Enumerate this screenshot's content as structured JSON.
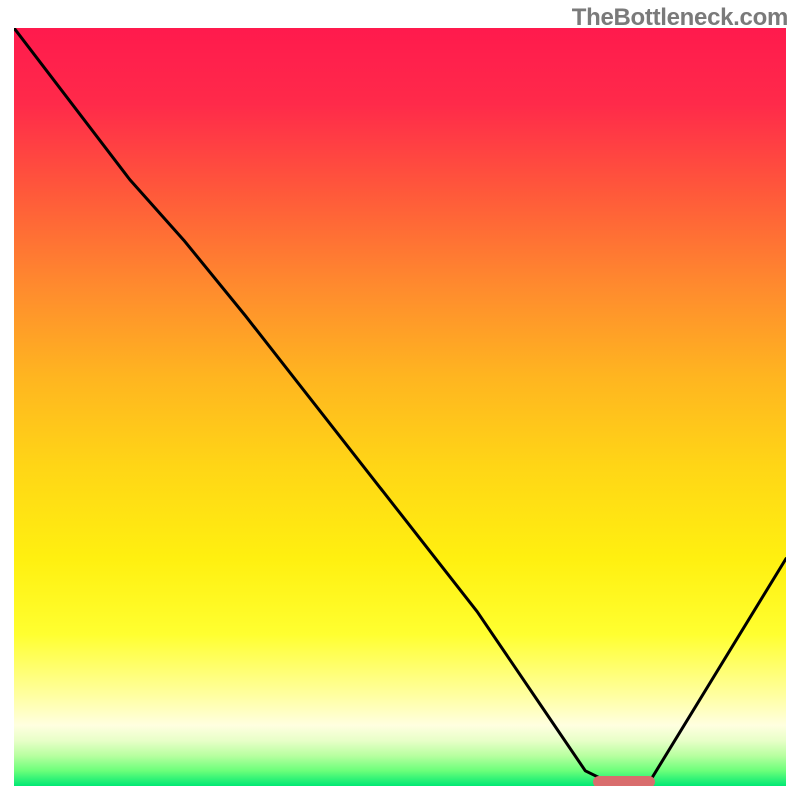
{
  "attribution": "TheBottleneck.com",
  "chart_data": {
    "type": "line",
    "title": "",
    "xlabel": "",
    "ylabel": "",
    "xlim": [
      0,
      100
    ],
    "ylim": [
      0,
      100
    ],
    "series": [
      {
        "name": "bottleneck-curve",
        "x": [
          0,
          15,
          22,
          30,
          40,
          50,
          60,
          68,
          74,
          78,
          82,
          100
        ],
        "y": [
          100,
          80,
          72,
          62,
          49,
          36,
          23,
          11,
          2,
          0,
          0,
          30
        ]
      }
    ],
    "marker": {
      "x_start": 75,
      "x_end": 83,
      "y": 0.5
    },
    "gradient_stops": [
      {
        "pct": 0,
        "color": "#ff1a4d"
      },
      {
        "pct": 10,
        "color": "#ff2a4a"
      },
      {
        "pct": 22,
        "color": "#ff5a3a"
      },
      {
        "pct": 34,
        "color": "#ff8a2e"
      },
      {
        "pct": 46,
        "color": "#ffb520"
      },
      {
        "pct": 58,
        "color": "#ffd616"
      },
      {
        "pct": 70,
        "color": "#fff010"
      },
      {
        "pct": 80,
        "color": "#ffff30"
      },
      {
        "pct": 88,
        "color": "#ffffa0"
      },
      {
        "pct": 92,
        "color": "#ffffe0"
      },
      {
        "pct": 94,
        "color": "#e8ffc8"
      },
      {
        "pct": 96,
        "color": "#b8ffa0"
      },
      {
        "pct": 98,
        "color": "#6bff7a"
      },
      {
        "pct": 100,
        "color": "#00e874"
      }
    ]
  }
}
